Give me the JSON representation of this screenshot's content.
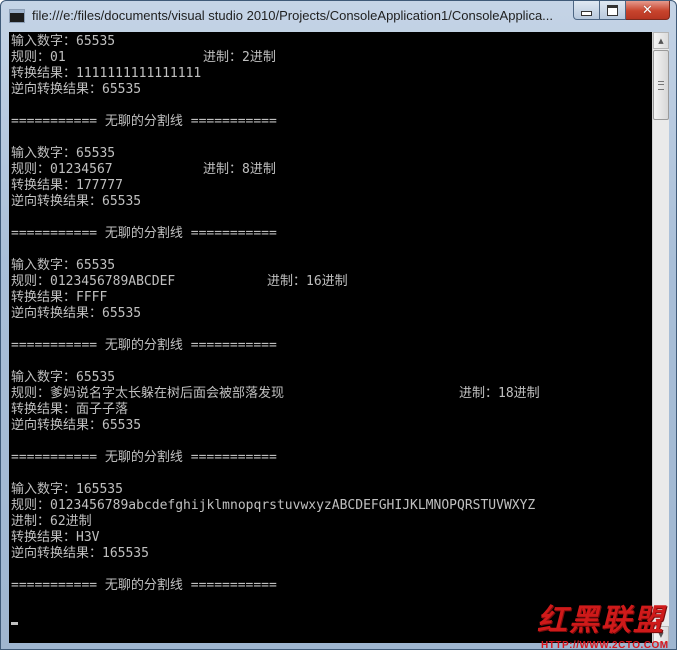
{
  "window": {
    "title": "file:///e:/files/documents/visual studio 2010/Projects/ConsoleApplication1/ConsoleApplica..."
  },
  "console": {
    "blocks": [
      {
        "input": "输入数字：65535",
        "rule": "规则：01",
        "base": "进制：2进制",
        "result": "转换结果：1111111111111111",
        "reverse": "逆向转换结果：65535"
      },
      {
        "input": "输入数字：65535",
        "rule": "规则：01234567",
        "base": "进制：8进制",
        "result": "转换结果：177777",
        "reverse": "逆向转换结果：65535"
      },
      {
        "input": "输入数字：65535",
        "rule": "规则：0123456789ABCDEF",
        "base": "进制：16进制",
        "result": "转换结果：FFFF",
        "reverse": "逆向转换结果：65535"
      },
      {
        "input": "输入数字：65535",
        "rule": "规则：爹妈说名字太长躲在树后面会被部落发现",
        "base": "进制：18进制",
        "result": "转换结果：面子子落",
        "reverse": "逆向转换结果：65535"
      },
      {
        "input": "输入数字：165535",
        "rule": "规则：0123456789abcdefghijklmnopqrstuvwxyzABCDEFGHIJKLMNOPQRSTUVWXYZ",
        "base": "进制：62进制",
        "result": "转换结果：H3V",
        "reverse": "逆向转换结果：165535"
      }
    ],
    "separator": "=========== 无聊的分割线 ==========="
  },
  "watermark": {
    "logo_text": "红黑联盟",
    "url": "HTTP://WWW.2CTO.COM"
  },
  "icons": {
    "app": "console-app-icon",
    "minimize": "minimize-icon",
    "maximize": "maximize-icon",
    "close": "close-icon",
    "scroll_up": "scroll-up-arrow-icon",
    "scroll_down": "scroll-down-arrow-icon"
  },
  "colors": {
    "console_bg": "#000000",
    "console_text": "#c0c0c0",
    "close_button": "#c8442d",
    "watermark": "#cf1a1a"
  }
}
